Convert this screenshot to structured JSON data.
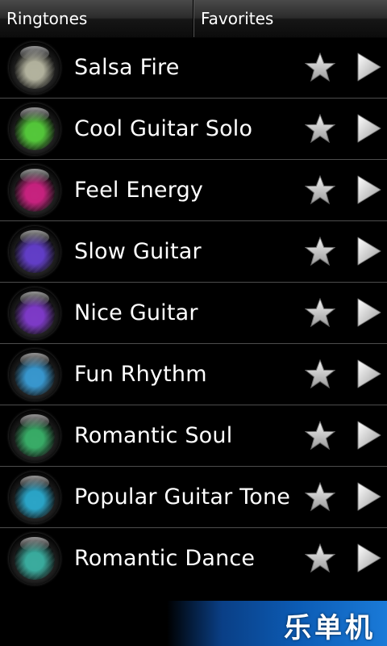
{
  "tabs": [
    {
      "label": "Ringtones"
    },
    {
      "label": "Favorites"
    }
  ],
  "items": [
    {
      "title": "Salsa Fire",
      "orb_color": "#c8c8b0"
    },
    {
      "title": "Cool Guitar Solo",
      "orb_color": "#5ae03c"
    },
    {
      "title": "Feel Energy",
      "orb_color": "#e0208c"
    },
    {
      "title": "Slow Guitar",
      "orb_color": "#6a40e0"
    },
    {
      "title": "Nice Guitar",
      "orb_color": "#8a3ce0"
    },
    {
      "title": "Fun Rhythm",
      "orb_color": "#3aa8e8"
    },
    {
      "title": "Romantic Soul",
      "orb_color": "#3ac070"
    },
    {
      "title": "Popular Guitar Tone",
      "orb_color": "#2ab8e0"
    },
    {
      "title": "Romantic Dance",
      "orb_color": "#3cc0b0"
    }
  ],
  "icons": {
    "favorite": "star-icon",
    "play": "play-icon"
  },
  "banner": {
    "text": "乐单机"
  },
  "colors": {
    "row_divider": "#4d4d4d",
    "banner_blue": "#0c5cb5"
  }
}
